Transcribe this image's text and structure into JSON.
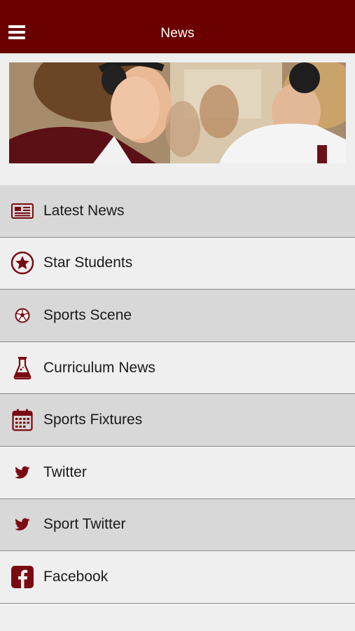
{
  "header": {
    "title": "News"
  },
  "menu": {
    "items": [
      {
        "label": "Latest News",
        "icon": "newspaper-icon"
      },
      {
        "label": "Star Students",
        "icon": "star-circle-icon"
      },
      {
        "label": "Sports Scene",
        "icon": "soccer-ball-icon"
      },
      {
        "label": "Curriculum News",
        "icon": "flask-icon"
      },
      {
        "label": "Sports Fixtures",
        "icon": "calendar-icon"
      },
      {
        "label": "Twitter",
        "icon": "twitter-icon"
      },
      {
        "label": "Sport Twitter",
        "icon": "twitter-icon"
      },
      {
        "label": "Facebook",
        "icon": "facebook-icon"
      }
    ]
  },
  "colors": {
    "brand": "#6b0000",
    "icon": "#7a0a12",
    "row_dark": "#d8d8d8",
    "row_light": "#efefef"
  }
}
